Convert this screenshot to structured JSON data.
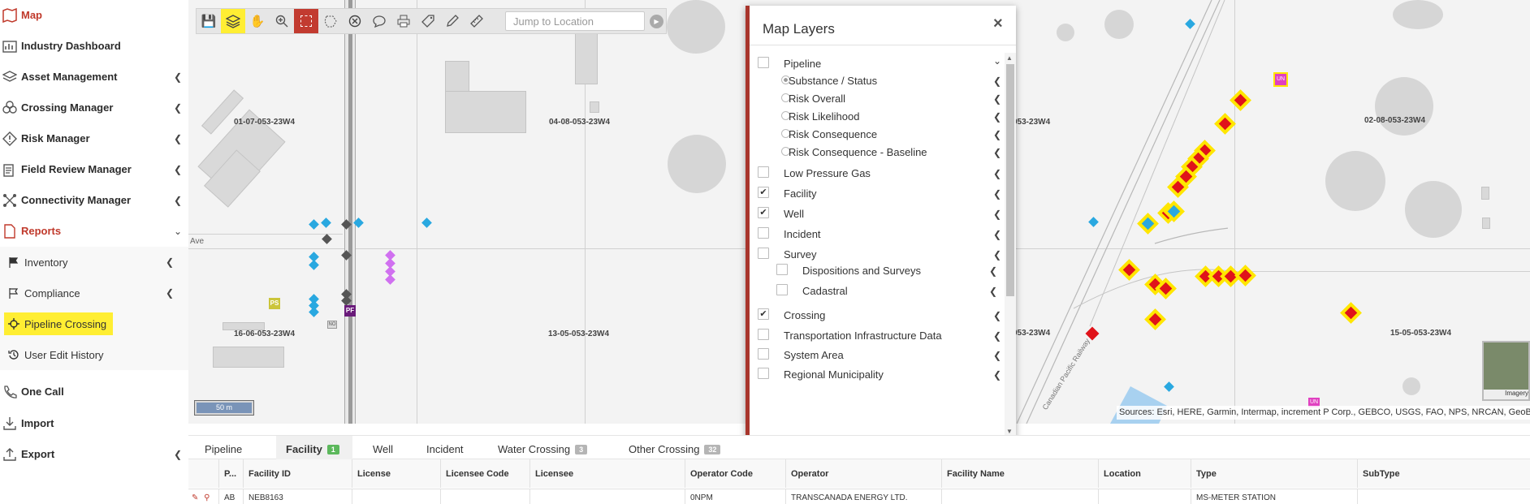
{
  "sidebar": {
    "items": [
      {
        "label": "Map",
        "icon": "map-icon",
        "active": true
      },
      {
        "label": "Industry Dashboard",
        "icon": "dashboard-icon"
      },
      {
        "label": "Asset Management",
        "icon": "layers-icon"
      },
      {
        "label": "Crossing Manager",
        "icon": "crossing-icon"
      },
      {
        "label": "Risk Manager",
        "icon": "warning-icon"
      },
      {
        "label": "Field Review Manager",
        "icon": "clipboard-icon"
      },
      {
        "label": "Connectivity Manager",
        "icon": "network-icon"
      },
      {
        "label": "Reports",
        "icon": "report-icon",
        "active": true
      },
      {
        "label": "One Call",
        "icon": "phone-icon"
      },
      {
        "label": "Import",
        "icon": "import-icon"
      },
      {
        "label": "Export",
        "icon": "export-icon"
      }
    ],
    "reports_sub": [
      {
        "label": "Inventory",
        "icon": "flag-icon"
      },
      {
        "label": "Compliance",
        "icon": "flag-icon"
      },
      {
        "label": "Pipeline Crossing",
        "icon": "crosshair-icon",
        "highlighted": true
      },
      {
        "label": "User Edit History",
        "icon": "history-icon"
      }
    ]
  },
  "toolbar": {
    "jump_placeholder": "Jump to Location"
  },
  "map": {
    "lsd_labels": [
      "01-07-053-23W4",
      "04-08-053-23W4",
      "16-06-053-23W4",
      "13-05-053-23W4",
      "053-23W4",
      "02-08-053-23W4",
      "053-23W4",
      "15-05-053-23W4"
    ],
    "road_label": "Ave",
    "railway_label": "Canadian Pacific Railway",
    "scale_label": "50 m",
    "attribution": "Sources: Esri, HERE, Garmin, Intermap, increment P Corp., GEBCO, USGS, FAO, NPS, NRCAN, GeoBase",
    "imagery_label": "Imagery",
    "markers": {
      "ps": "PS",
      "pf": "PF",
      "un": "UN",
      "no": "NO"
    },
    "colors": {
      "well": "#29a8e0",
      "facility": "#e0131a",
      "highlight": "#ffe600",
      "crossing": "#d070f0",
      "node": "#555555"
    }
  },
  "layers_panel": {
    "title": "Map Layers",
    "close": "×",
    "rows": [
      {
        "label": "Pipeline",
        "type": "checkbox",
        "checked": false,
        "chevron": "⌄"
      },
      {
        "label": "Substance / Status",
        "type": "radio",
        "selected": true
      },
      {
        "label": "Risk Overall",
        "type": "radio"
      },
      {
        "label": "Risk Likelihood",
        "type": "radio"
      },
      {
        "label": "Risk Consequence",
        "type": "radio"
      },
      {
        "label": "Risk Consequence - Baseline",
        "type": "radio"
      },
      {
        "label": "Low Pressure Gas",
        "type": "checkbox",
        "checked": false
      },
      {
        "label": "Facility",
        "type": "checkbox",
        "checked": true
      },
      {
        "label": "Well",
        "type": "checkbox",
        "checked": true
      },
      {
        "label": "Incident",
        "type": "checkbox",
        "checked": false
      },
      {
        "label": "Survey",
        "type": "checkbox",
        "checked": false
      },
      {
        "label": "Dispositions and Surveys",
        "type": "checkbox",
        "checked": false,
        "indent": true
      },
      {
        "label": "Cadastral",
        "type": "checkbox",
        "checked": false,
        "indent": true
      },
      {
        "label": "Crossing",
        "type": "checkbox",
        "checked": true
      },
      {
        "label": "Transportation Infrastructure Data",
        "type": "checkbox",
        "checked": false
      },
      {
        "label": "System Area",
        "type": "checkbox",
        "checked": false
      },
      {
        "label": "Regional Municipality",
        "type": "checkbox",
        "checked": false
      }
    ]
  },
  "tabs": [
    {
      "label": "Pipeline"
    },
    {
      "label": "Facility",
      "badge": "1",
      "active": true
    },
    {
      "label": "Well"
    },
    {
      "label": "Incident"
    },
    {
      "label": "Water Crossing",
      "badge": "3"
    },
    {
      "label": "Other Crossing",
      "badge": "32"
    }
  ],
  "table": {
    "headers": [
      "P...",
      "Facility ID",
      "License",
      "Licensee Code",
      "Licensee",
      "Operator Code",
      "Operator",
      "Facility Name",
      "Location",
      "Type",
      "SubType"
    ],
    "rows": [
      [
        "AB",
        "NEB8163",
        "",
        "",
        "",
        "0NPM",
        "TRANSCANADA ENERGY LTD.",
        "",
        "",
        "MS-METER STATION",
        ""
      ]
    ]
  }
}
